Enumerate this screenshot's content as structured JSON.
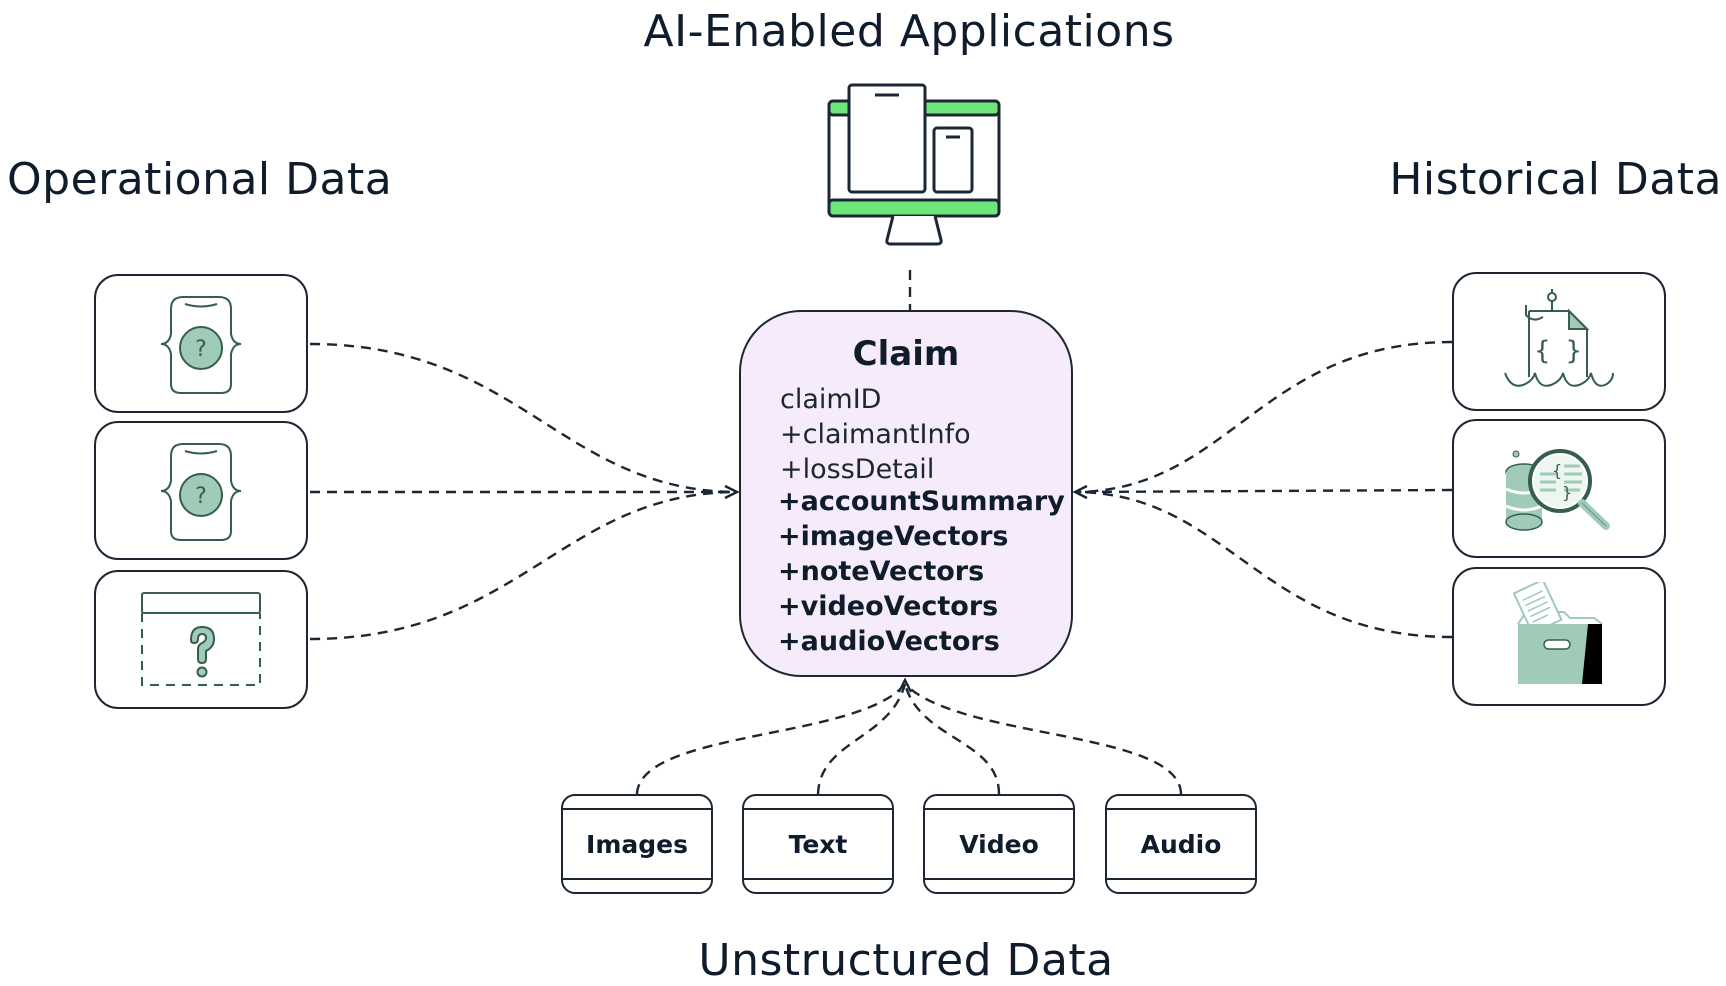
{
  "titles": {
    "apps": "AI-Enabled Applications",
    "operational": "Operational Data",
    "historical": "Historical Data",
    "unstructured": "Unstructured Data"
  },
  "claim": {
    "title": "Claim",
    "fields": [
      {
        "text": "claimID",
        "bold": false
      },
      {
        "text": "+claimantInfo",
        "bold": false
      },
      {
        "text": "+lossDetail",
        "bold": false
      },
      {
        "text": "+accountSummary",
        "bold": true
      },
      {
        "text": "+imageVectors",
        "bold": true
      },
      {
        "text": "+noteVectors",
        "bold": true
      },
      {
        "text": "+videoVectors",
        "bold": true
      },
      {
        "text": "+audioVectors",
        "bold": true
      }
    ]
  },
  "operational_sources": [
    {
      "icon": "json-document-unknown-icon"
    },
    {
      "icon": "json-document-unknown-icon"
    },
    {
      "icon": "unknown-table-icon"
    }
  ],
  "historical_sources": [
    {
      "icon": "data-lake-document-icon"
    },
    {
      "icon": "database-search-icon"
    },
    {
      "icon": "archive-box-icon"
    }
  ],
  "unstructured_sources": [
    {
      "label": "Images"
    },
    {
      "label": "Text"
    },
    {
      "label": "Video"
    },
    {
      "label": "Audio"
    }
  ],
  "colors": {
    "accent_green": "#6ee67a",
    "icon_green": "#9fcbb8",
    "icon_stroke": "#355e4b",
    "claim_fill": "#f6ebfb",
    "stroke": "#1c2733"
  }
}
